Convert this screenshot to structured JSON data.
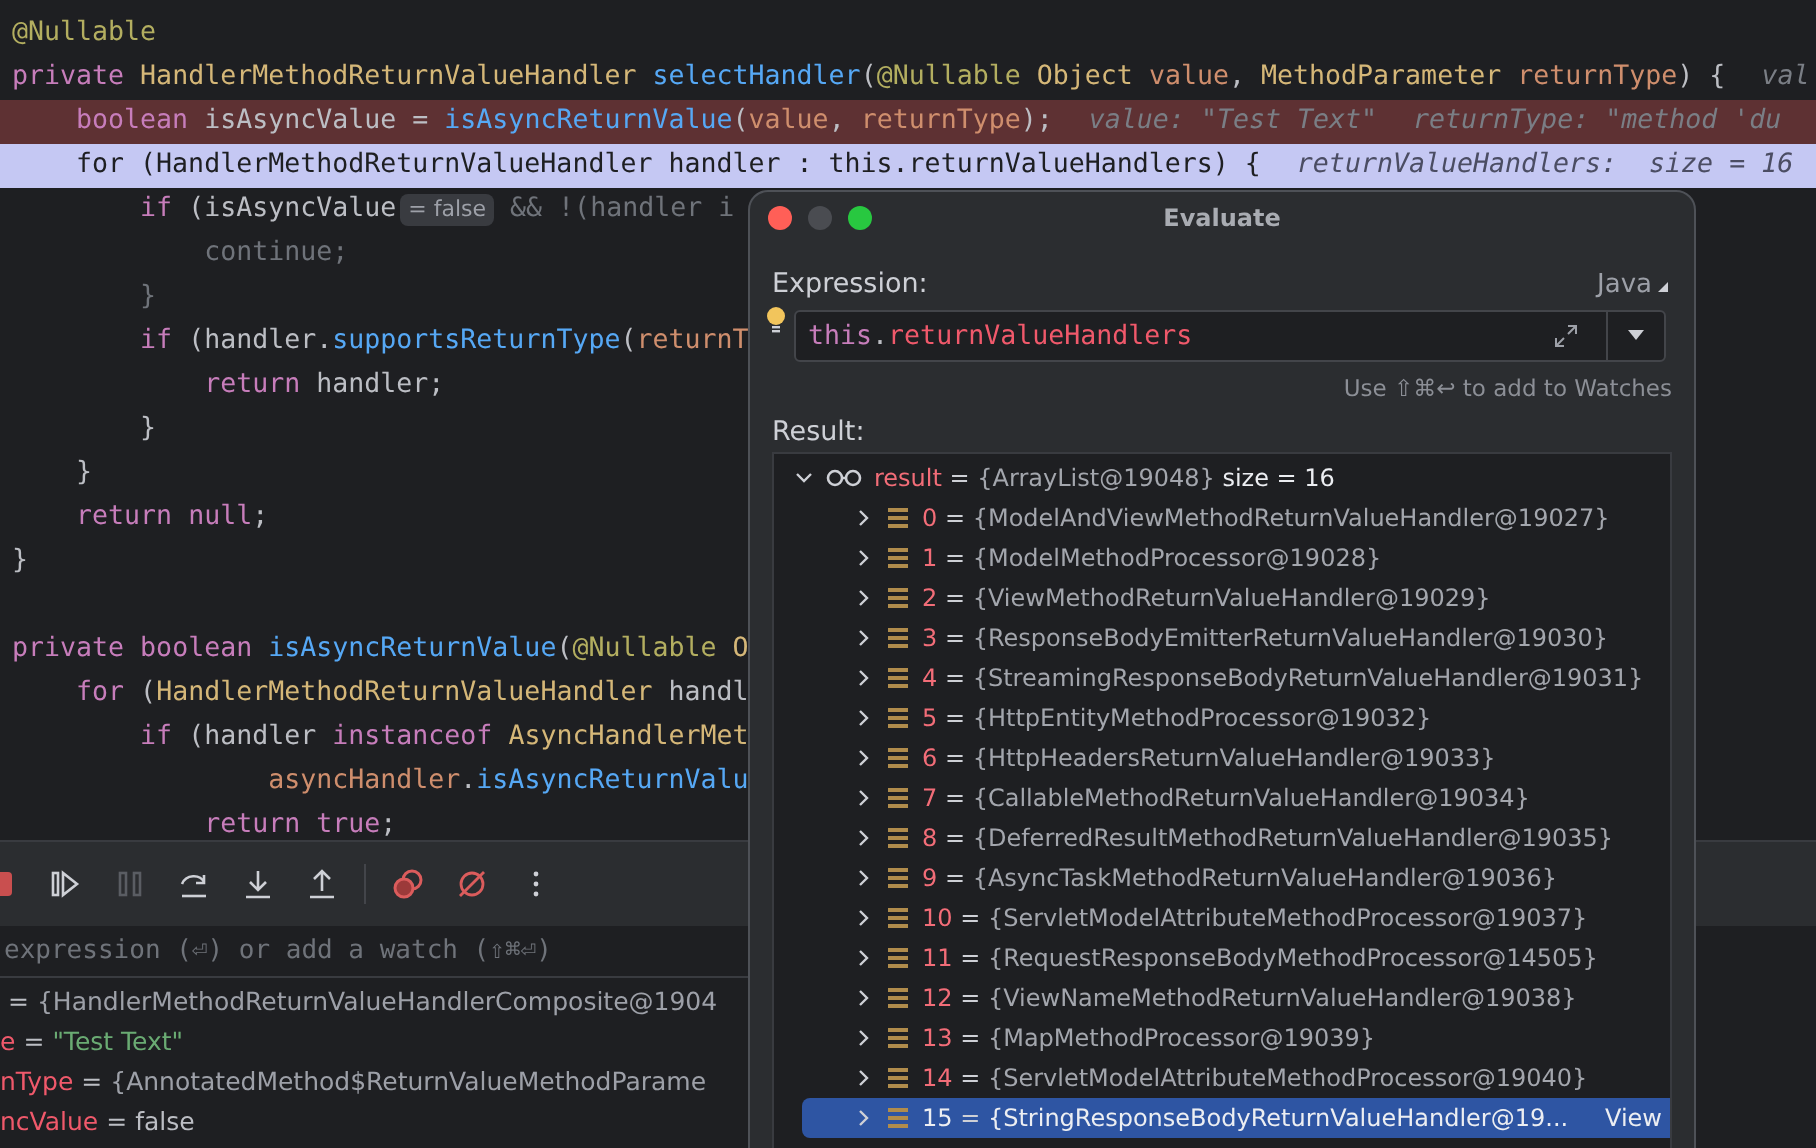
{
  "editor": {
    "lines": [
      {
        "segments": [
          {
            "kind": "code",
            "tokens": [
              {
                "kind": "annotation",
                "text": "@Nullable"
              }
            ]
          }
        ]
      },
      {
        "segments": [
          {
            "kind": "code",
            "tokens": [
              {
                "kind": "keyword",
                "text": "private"
              },
              {
                "kind": "type",
                "text": " HandlerMethodReturnValueHandler"
              },
              {
                "kind": "function",
                "text": " selectHandler"
              },
              {
                "kind": "plain",
                "text": "("
              },
              {
                "kind": "annotation",
                "text": "@Nullable"
              },
              {
                "kind": "type",
                "text": " Object"
              },
              {
                "kind": "parameter",
                "text": " value"
              },
              {
                "kind": "plain",
                "text": ","
              },
              {
                "kind": "type",
                "text": " MethodParameter"
              },
              {
                "kind": "parameter",
                "text": " returnType"
              },
              {
                "kind": "plain",
                "text": ") {"
              }
            ]
          },
          {
            "kind": "hint",
            "text": "val"
          }
        ]
      },
      {
        "kind": "breakpoint",
        "segments": [
          {
            "kind": "code",
            "tokens": [
              {
                "kind": "keyword",
                "text": "    boolean"
              },
              {
                "kind": "plain",
                "text": " isAsyncValue ="
              },
              {
                "kind": "function",
                "text": " isAsyncReturnValue"
              },
              {
                "kind": "plain",
                "text": "("
              },
              {
                "kind": "parameter",
                "text": "value"
              },
              {
                "kind": "plain",
                "text": ","
              },
              {
                "kind": "parameter",
                "text": " returnType"
              },
              {
                "kind": "plain",
                "text": ");"
              }
            ]
          },
          {
            "kind": "hint",
            "text": "value: \"Test Text\""
          },
          {
            "kind": "hint",
            "text": "returnType: \"method 'du"
          }
        ]
      },
      {
        "kind": "execution",
        "segments": [
          {
            "kind": "code",
            "tokens": [
              {
                "kind": "plain",
                "text": "    for (HandlerMethodReturnValueHandler handler : this.returnValueHandlers) {"
              }
            ]
          },
          {
            "kind": "hint",
            "text": "returnValueHandlers:  size = 16"
          }
        ]
      },
      {
        "segments": [
          {
            "kind": "code",
            "tokens": [
              {
                "kind": "keyword",
                "text": "        if"
              },
              {
                "kind": "plain",
                "text": " (isAsyncValue"
              }
            ]
          },
          {
            "kind": "badge",
            "text": "= false"
          },
          {
            "kind": "code",
            "tokens": [
              {
                "kind": "dim",
                "text": " && !(handler i"
              }
            ]
          }
        ]
      },
      {
        "segments": [
          {
            "kind": "code",
            "tokens": [
              {
                "kind": "dim",
                "text": "            continue;"
              }
            ]
          }
        ]
      },
      {
        "segments": [
          {
            "kind": "code",
            "tokens": [
              {
                "kind": "dim",
                "text": "        }"
              }
            ]
          }
        ]
      },
      {
        "segments": [
          {
            "kind": "code",
            "tokens": [
              {
                "kind": "keyword",
                "text": "        if"
              },
              {
                "kind": "plain",
                "text": " (handler."
              },
              {
                "kind": "function",
                "text": "supportsReturnType"
              },
              {
                "kind": "plain",
                "text": "("
              },
              {
                "kind": "parameter",
                "text": "returnT"
              }
            ]
          }
        ]
      },
      {
        "segments": [
          {
            "kind": "code",
            "tokens": [
              {
                "kind": "keyword",
                "text": "            return"
              },
              {
                "kind": "plain",
                "text": " handler;"
              }
            ]
          }
        ]
      },
      {
        "segments": [
          {
            "kind": "code",
            "tokens": [
              {
                "kind": "plain",
                "text": "        }"
              }
            ]
          }
        ]
      },
      {
        "segments": [
          {
            "kind": "code",
            "tokens": [
              {
                "kind": "plain",
                "text": "    }"
              }
            ]
          }
        ]
      },
      {
        "segments": [
          {
            "kind": "code",
            "tokens": [
              {
                "kind": "keyword",
                "text": "    return"
              },
              {
                "kind": "keyword",
                "text": " null"
              },
              {
                "kind": "plain",
                "text": ";"
              }
            ]
          }
        ]
      },
      {
        "segments": [
          {
            "kind": "code",
            "tokens": [
              {
                "kind": "plain",
                "text": "}"
              }
            ]
          }
        ]
      },
      {
        "kind": "blank"
      },
      {
        "segments": [
          {
            "kind": "code",
            "tokens": [
              {
                "kind": "keyword",
                "text": "private"
              },
              {
                "kind": "keyword",
                "text": " boolean"
              },
              {
                "kind": "function",
                "text": " isAsyncReturnValue"
              },
              {
                "kind": "plain",
                "text": "("
              },
              {
                "kind": "annotation",
                "text": "@Nullable"
              },
              {
                "kind": "type",
                "text": " O"
              }
            ]
          }
        ]
      },
      {
        "segments": [
          {
            "kind": "code",
            "tokens": [
              {
                "kind": "keyword",
                "text": "    for"
              },
              {
                "kind": "plain",
                "text": " ("
              },
              {
                "kind": "type",
                "text": "HandlerMethodReturnValueHandler"
              },
              {
                "kind": "plain",
                "text": " handl"
              }
            ]
          }
        ]
      },
      {
        "segments": [
          {
            "kind": "code",
            "tokens": [
              {
                "kind": "keyword",
                "text": "        if"
              },
              {
                "kind": "plain",
                "text": " (handler"
              },
              {
                "kind": "keyword",
                "text": " instanceof"
              },
              {
                "kind": "type",
                "text": " AsyncHandlerMet"
              }
            ]
          }
        ]
      },
      {
        "segments": [
          {
            "kind": "code",
            "tokens": [
              {
                "kind": "parameter",
                "text": "                asyncHandler"
              },
              {
                "kind": "plain",
                "text": "."
              },
              {
                "kind": "function",
                "text": "isAsyncReturnValu"
              }
            ]
          }
        ]
      },
      {
        "segments": [
          {
            "kind": "code",
            "tokens": [
              {
                "kind": "keyword",
                "text": "            return"
              },
              {
                "kind": "keyword",
                "text": " true"
              },
              {
                "kind": "plain",
                "text": ";"
              }
            ]
          }
        ]
      }
    ]
  },
  "debugger": {
    "toolbar": [
      {
        "kind": "stop"
      },
      {
        "kind": "resume"
      },
      {
        "kind": "pause",
        "disabled": true
      },
      {
        "kind": "step-over"
      },
      {
        "kind": "step-into"
      },
      {
        "kind": "step-out"
      },
      {
        "kind": "separator"
      },
      {
        "kind": "breakpoints"
      },
      {
        "kind": "mute"
      },
      {
        "kind": "more"
      }
    ],
    "watch_field": {
      "placeholder": "expression (⏎) or add a watch (⇧⌘⏎)"
    },
    "variables": [
      {
        "eq": "=",
        "value": "{HandlerMethodReturnValueHandlerComposite@1904",
        "kind": "object"
      },
      {
        "name": "e",
        "eq": "=",
        "value": "\"Test Text\"",
        "kind": "string"
      },
      {
        "name": "nType",
        "eq": "=",
        "value": "{AnnotatedMethod$ReturnValueMethodParame",
        "kind": "object"
      },
      {
        "name": "ncValue",
        "eq": "=",
        "value": "false",
        "kind": "primitive"
      }
    ]
  },
  "evaluate_dialog": {
    "title": "Evaluate",
    "expression_label": "Expression:",
    "language": "Java",
    "expression": [
      {
        "kind": "keyword",
        "text": "this"
      },
      {
        "kind": "plain",
        "text": "."
      },
      {
        "kind": "field",
        "text": "returnValueHandlers"
      }
    ],
    "hint": "Use ⇧⌘↩ to add to Watches",
    "result_label": "Result:",
    "result": {
      "name": "result",
      "eq": "=",
      "value": "{ArrayList@19048}",
      "extra": "size = 16",
      "expanded": true,
      "children": [
        {
          "index": "0",
          "eq": "=",
          "value": "{ModelAndViewMethodReturnValueHandler@19027}",
          "selected": false
        },
        {
          "index": "1",
          "eq": "=",
          "value": "{ModelMethodProcessor@19028}",
          "selected": false
        },
        {
          "index": "2",
          "eq": "=",
          "value": "{ViewMethodReturnValueHandler@19029}",
          "selected": false
        },
        {
          "index": "3",
          "eq": "=",
          "value": "{ResponseBodyEmitterReturnValueHandler@19030}",
          "selected": false
        },
        {
          "index": "4",
          "eq": "=",
          "value": "{StreamingResponseBodyReturnValueHandler@19031}",
          "selected": false
        },
        {
          "index": "5",
          "eq": "=",
          "value": "{HttpEntityMethodProcessor@19032}",
          "selected": false
        },
        {
          "index": "6",
          "eq": "=",
          "value": "{HttpHeadersReturnValueHandler@19033}",
          "selected": false
        },
        {
          "index": "7",
          "eq": "=",
          "value": "{CallableMethodReturnValueHandler@19034}",
          "selected": false
        },
        {
          "index": "8",
          "eq": "=",
          "value": "{DeferredResultMethodReturnValueHandler@19035}",
          "selected": false
        },
        {
          "index": "9",
          "eq": "=",
          "value": "{AsyncTaskMethodReturnValueHandler@19036}",
          "selected": false
        },
        {
          "index": "10",
          "eq": "=",
          "value": "{ServletModelAttributeMethodProcessor@19037}",
          "selected": false
        },
        {
          "index": "11",
          "eq": "=",
          "value": "{RequestResponseBodyMethodProcessor@14505}",
          "selected": false
        },
        {
          "index": "12",
          "eq": "=",
          "value": "{ViewNameMethodReturnValueHandler@19038}",
          "selected": false
        },
        {
          "index": "13",
          "eq": "=",
          "value": "{MapMethodProcessor@19039}",
          "selected": false
        },
        {
          "index": "14",
          "eq": "=",
          "value": "{ServletModelAttributeMethodProcessor@19040}",
          "selected": false
        },
        {
          "index": "15",
          "eq": "=",
          "value": "{StringResponseBodyReturnValueHandler@19...",
          "selected": true,
          "link": "View"
        }
      ]
    }
  }
}
